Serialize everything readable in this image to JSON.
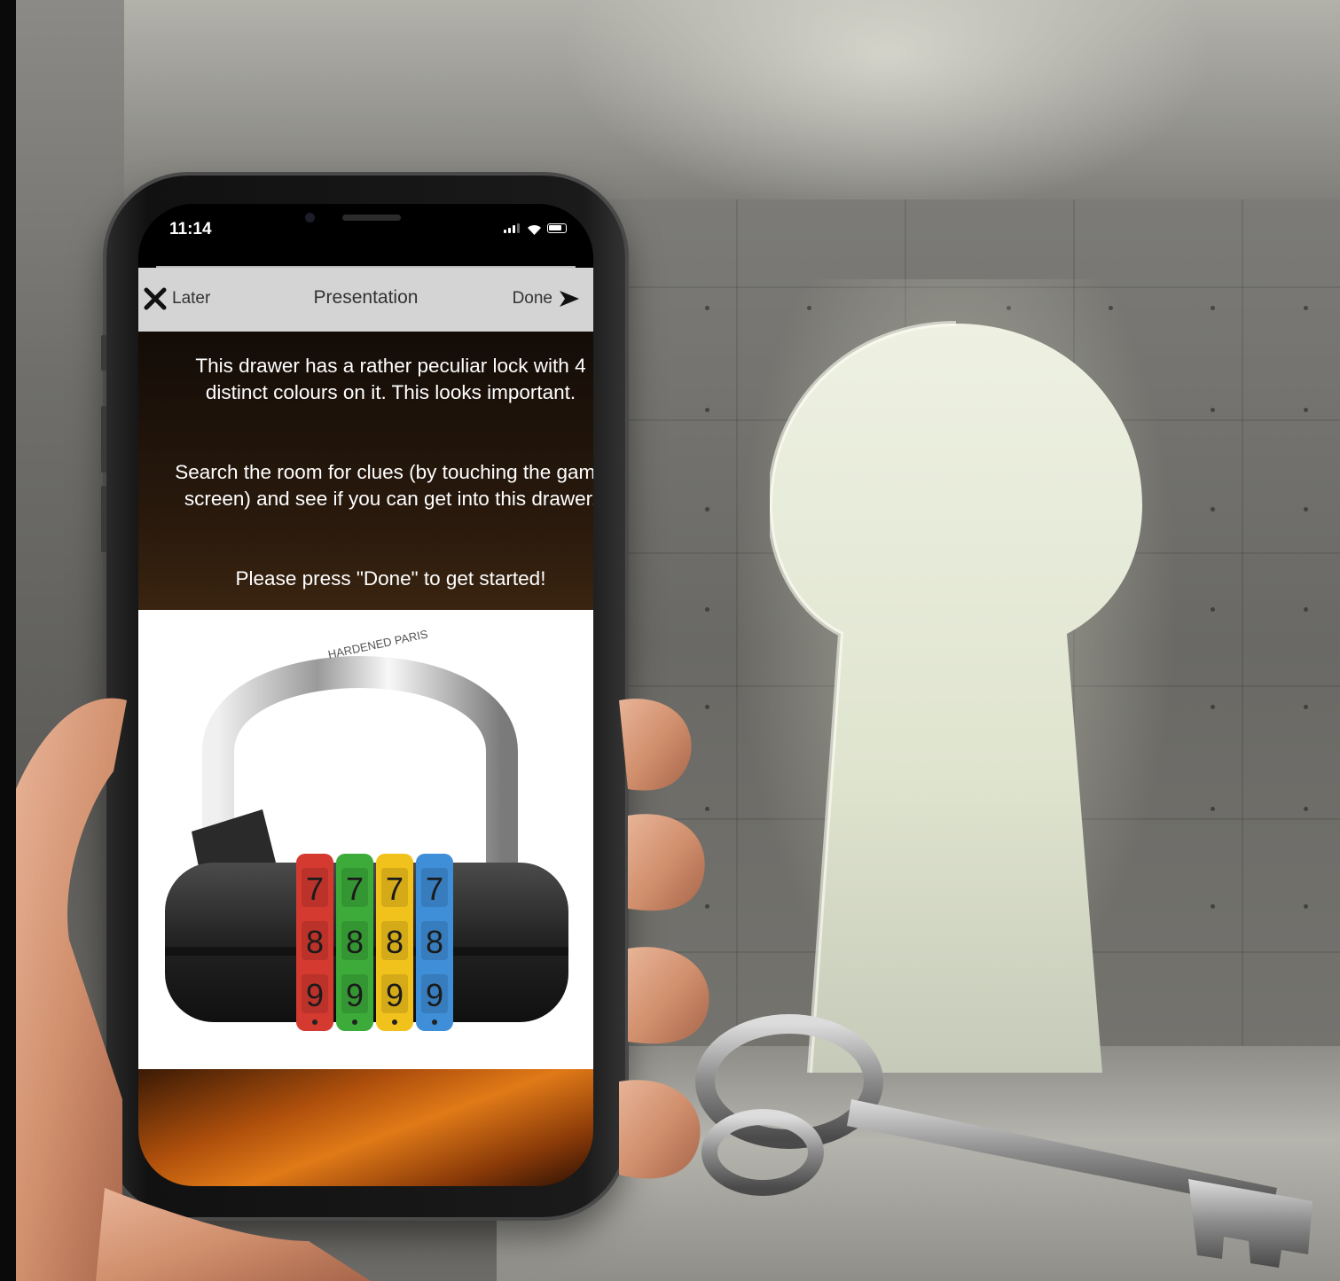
{
  "status_bar": {
    "time": "11:14"
  },
  "navbar": {
    "later_label": "Later",
    "title": "Presentation",
    "done_label": "Done"
  },
  "message": {
    "paragraph_1": "This drawer has a rather peculiar lock with 4 distinct colours on it. This looks important.",
    "paragraph_2": "Search the room for clues (by touching the game screen) and see if you can get into this drawer.",
    "paragraph_3": "Please press \"Done\" to get started!"
  },
  "padlock": {
    "shackle_engraving": "HARDENED PARIS",
    "wheels": [
      {
        "color": "#d43a2f",
        "digits": [
          "7",
          "8",
          "9"
        ]
      },
      {
        "color": "#3cab3a",
        "digits": [
          "7",
          "8",
          "9"
        ]
      },
      {
        "color": "#f2c21c",
        "digits": [
          "7",
          "8",
          "9"
        ]
      },
      {
        "color": "#3f8ed8",
        "digits": [
          "7",
          "8",
          "9"
        ]
      }
    ]
  },
  "colors": {
    "navbar_bg": "#d4d4d4",
    "panel_dark": "#130c07",
    "accent_orange": "#e07a18"
  },
  "icons": {
    "later": "close-x-icon",
    "done": "arrow-right-icon",
    "signal": "cellular-signal-icon",
    "wifi": "wifi-icon",
    "battery": "battery-icon"
  }
}
